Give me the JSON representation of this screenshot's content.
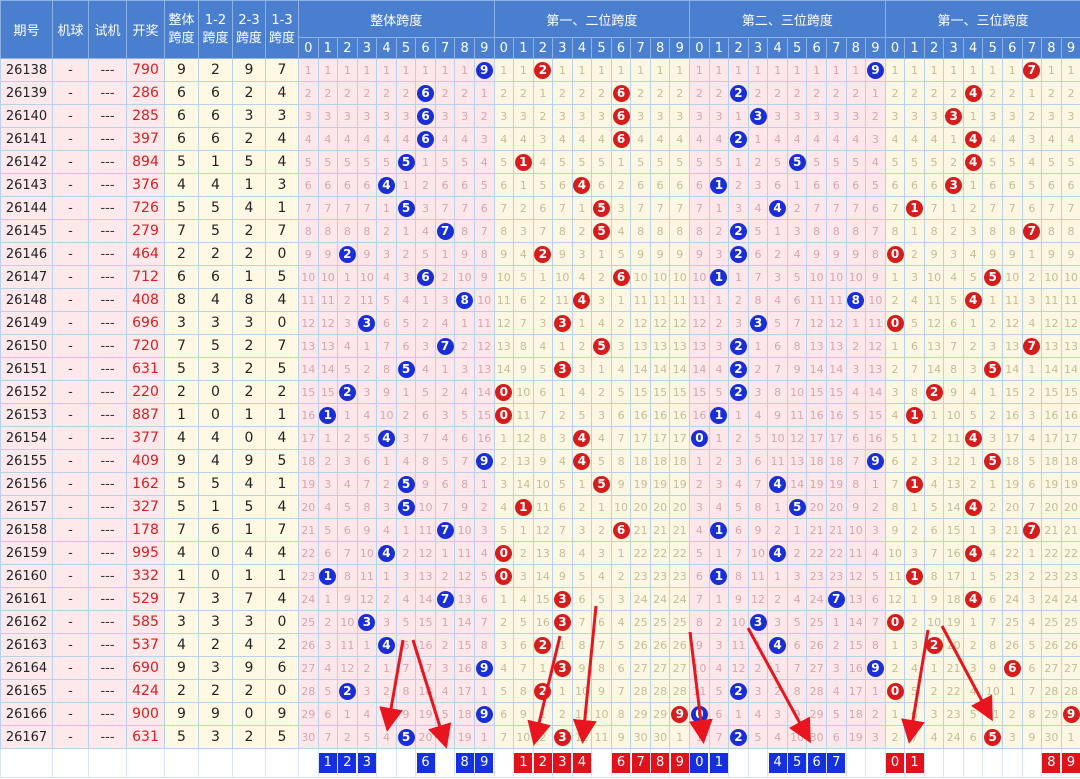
{
  "headers": {
    "period": "期号",
    "machine": "机球",
    "trial": "试机",
    "draw": "开奖",
    "span_all": "整体跨度",
    "span_12": "1-2跨度",
    "span_23": "2-3跨度",
    "span_13": "1-3跨度",
    "groups": [
      "整体跨度",
      "第一、二位跨度",
      "第二、三位跨度",
      "第一、三位跨度"
    ],
    "digits": [
      "0",
      "1",
      "2",
      "3",
      "4",
      "5",
      "6",
      "7",
      "8",
      "9"
    ]
  },
  "colors": {
    "header_bg": "#4a7fd0",
    "blue_ball": "#1a2ed6",
    "red_ball": "#d51d1d",
    "draw_text": "#d32020"
  },
  "rows": [
    {
      "p": "26138",
      "mq": "-",
      "sj": "---",
      "kj": "790",
      "s": [
        9,
        2,
        9,
        7
      ]
    },
    {
      "p": "26139",
      "mq": "-",
      "sj": "---",
      "kj": "286",
      "s": [
        6,
        6,
        2,
        4
      ]
    },
    {
      "p": "26140",
      "mq": "-",
      "sj": "---",
      "kj": "285",
      "s": [
        6,
        6,
        3,
        3
      ]
    },
    {
      "p": "26141",
      "mq": "-",
      "sj": "---",
      "kj": "397",
      "s": [
        6,
        6,
        2,
        4
      ]
    },
    {
      "p": "26142",
      "mq": "-",
      "sj": "---",
      "kj": "894",
      "s": [
        5,
        1,
        5,
        4
      ]
    },
    {
      "p": "26143",
      "mq": "-",
      "sj": "---",
      "kj": "376",
      "s": [
        4,
        4,
        1,
        3
      ]
    },
    {
      "p": "26144",
      "mq": "-",
      "sj": "---",
      "kj": "726",
      "s": [
        5,
        5,
        4,
        1
      ]
    },
    {
      "p": "26145",
      "mq": "-",
      "sj": "---",
      "kj": "279",
      "s": [
        7,
        5,
        2,
        7
      ]
    },
    {
      "p": "26146",
      "mq": "-",
      "sj": "---",
      "kj": "464",
      "s": [
        2,
        2,
        2,
        0
      ]
    },
    {
      "p": "26147",
      "mq": "-",
      "sj": "---",
      "kj": "712",
      "s": [
        6,
        6,
        1,
        5
      ]
    },
    {
      "p": "26148",
      "mq": "-",
      "sj": "---",
      "kj": "408",
      "s": [
        8,
        4,
        8,
        4
      ]
    },
    {
      "p": "26149",
      "mq": "-",
      "sj": "---",
      "kj": "696",
      "s": [
        3,
        3,
        3,
        0
      ]
    },
    {
      "p": "26150",
      "mq": "-",
      "sj": "---",
      "kj": "720",
      "s": [
        7,
        5,
        2,
        7
      ]
    },
    {
      "p": "26151",
      "mq": "-",
      "sj": "---",
      "kj": "631",
      "s": [
        5,
        3,
        2,
        5
      ]
    },
    {
      "p": "26152",
      "mq": "-",
      "sj": "---",
      "kj": "220",
      "s": [
        2,
        0,
        2,
        2
      ]
    },
    {
      "p": "26153",
      "mq": "-",
      "sj": "---",
      "kj": "887",
      "s": [
        1,
        0,
        1,
        1
      ]
    },
    {
      "p": "26154",
      "mq": "-",
      "sj": "---",
      "kj": "377",
      "s": [
        4,
        4,
        0,
        4
      ]
    },
    {
      "p": "26155",
      "mq": "-",
      "sj": "---",
      "kj": "409",
      "s": [
        9,
        4,
        9,
        5
      ]
    },
    {
      "p": "26156",
      "mq": "-",
      "sj": "---",
      "kj": "162",
      "s": [
        5,
        5,
        4,
        1
      ]
    },
    {
      "p": "26157",
      "mq": "-",
      "sj": "---",
      "kj": "327",
      "s": [
        5,
        1,
        5,
        4
      ]
    },
    {
      "p": "26158",
      "mq": "-",
      "sj": "---",
      "kj": "178",
      "s": [
        7,
        6,
        1,
        7
      ]
    },
    {
      "p": "26159",
      "mq": "-",
      "sj": "---",
      "kj": "995",
      "s": [
        4,
        0,
        4,
        4
      ]
    },
    {
      "p": "26160",
      "mq": "-",
      "sj": "---",
      "kj": "332",
      "s": [
        1,
        0,
        1,
        1
      ]
    },
    {
      "p": "26161",
      "mq": "-",
      "sj": "---",
      "kj": "529",
      "s": [
        7,
        3,
        7,
        4
      ]
    },
    {
      "p": "26162",
      "mq": "-",
      "sj": "---",
      "kj": "585",
      "s": [
        3,
        3,
        3,
        0
      ]
    },
    {
      "p": "26163",
      "mq": "-",
      "sj": "---",
      "kj": "537",
      "s": [
        4,
        2,
        4,
        2
      ]
    },
    {
      "p": "26164",
      "mq": "-",
      "sj": "---",
      "kj": "690",
      "s": [
        9,
        3,
        9,
        6
      ]
    },
    {
      "p": "26165",
      "mq": "-",
      "sj": "---",
      "kj": "424",
      "s": [
        2,
        2,
        2,
        0
      ]
    },
    {
      "p": "26166",
      "mq": "-",
      "sj": "---",
      "kj": "900",
      "s": [
        9,
        9,
        0,
        9
      ]
    },
    {
      "p": "26167",
      "mq": "-",
      "sj": "---",
      "kj": "631",
      "s": [
        5,
        3,
        2,
        5
      ]
    }
  ],
  "selected": [
    [
      "1",
      "2",
      "3",
      "",
      "",
      "6",
      "",
      "8",
      "9"
    ],
    [
      "1",
      "2",
      "3",
      "4",
      "",
      "6",
      "7",
      "8",
      "9"
    ],
    [
      "0",
      "1",
      "",
      "",
      "4",
      "5",
      "6",
      "7"
    ],
    [
      "0",
      "1",
      "",
      "",
      "",
      "",
      "",
      "8",
      "9"
    ]
  ],
  "selected_digits": [
    [
      1,
      2,
      3,
      6,
      8,
      9
    ],
    [
      1,
      2,
      3,
      4,
      6,
      7,
      8,
      9
    ],
    [
      0,
      1,
      4,
      5,
      6,
      7
    ],
    [
      0,
      1,
      8,
      9
    ]
  ]
}
